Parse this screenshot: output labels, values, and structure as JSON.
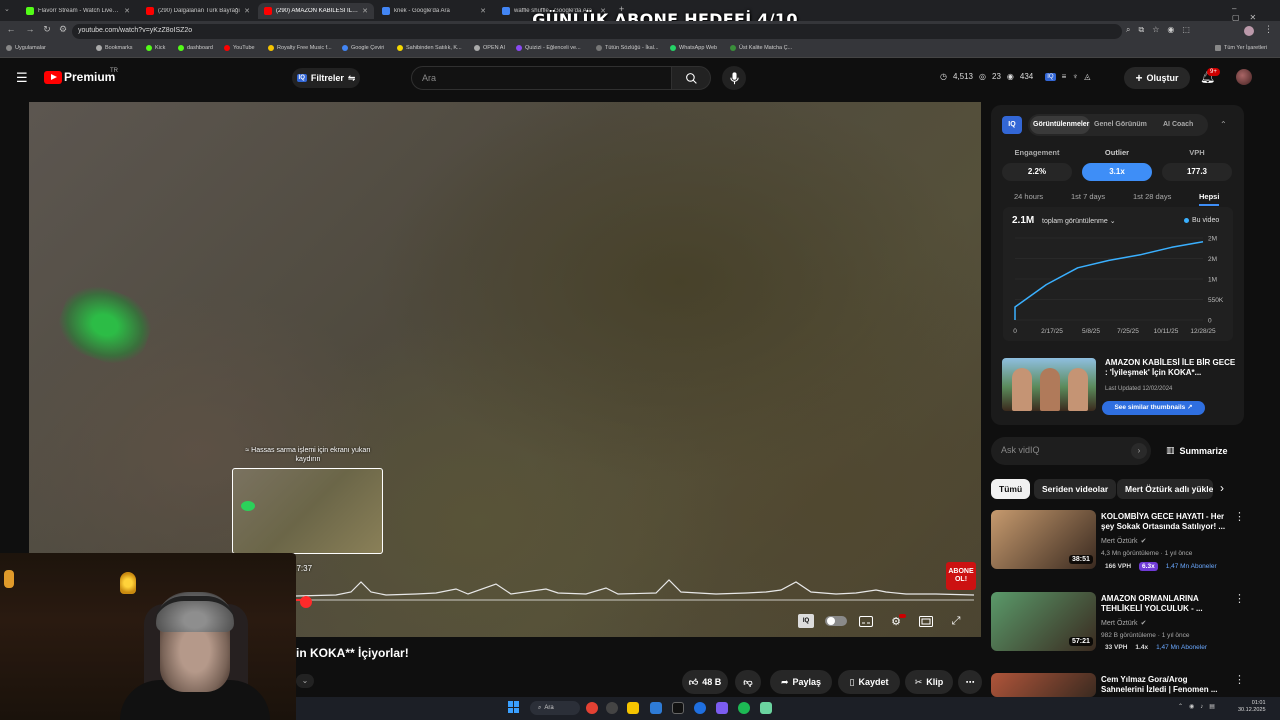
{
  "overlay_title": "GÜNLÜK ABONE HEDEFİ 4/10",
  "browser": {
    "tabs": [
      {
        "title": "Flavorr Stream - Watch Live on",
        "color": "#53fc18"
      },
      {
        "title": "(290) Dalgalanan Türk Bayrağı",
        "color": "#ff0000"
      },
      {
        "title": "(290) AMAZON KABİLESİ İLE BİR",
        "color": "#ff0000"
      },
      {
        "title": "kriek - Google'da Ara",
        "color": "#4285f4"
      },
      {
        "title": "waffle shuffle - Google'da Ara",
        "color": "#4285f4"
      }
    ],
    "url": "youtube.com/watch?v=yKzZ8oISZ2o",
    "bookmarks": [
      {
        "label": "Uygulamalar",
        "color": "#888"
      },
      {
        "label": "Bookmarks",
        "color": "#aaa"
      },
      {
        "label": "Kick",
        "color": "#53fc18"
      },
      {
        "label": "dashboard",
        "color": "#53fc18"
      },
      {
        "label": "YouTube",
        "color": "#ff0000"
      },
      {
        "label": "Royalty Free Music f...",
        "color": "#f5c400"
      },
      {
        "label": "Google Çeviri",
        "color": "#4285f4"
      },
      {
        "label": "Sahibinden Satılık, K...",
        "color": "#f5d800"
      },
      {
        "label": "OPEN AI",
        "color": "#aaa"
      },
      {
        "label": "Quizizi - Eğlenceli ve...",
        "color": "#8a4af3"
      },
      {
        "label": "Tütün Sözlüğü - İkal...",
        "color": "#777"
      },
      {
        "label": "WhatsApp Web",
        "color": "#25d366"
      },
      {
        "label": "Üst Kalite Matcha Ç...",
        "color": "#3a8f3a"
      }
    ],
    "all_bookmarks": "Tüm Yer İşaretleri"
  },
  "header": {
    "logo": "Premium",
    "logo_sup": "TR",
    "filters": "Filtreler",
    "search_placeholder": "Ara",
    "stats": [
      "4,513",
      "23",
      "434"
    ],
    "create": "Oluştur",
    "notif_count": "9+"
  },
  "video": {
    "preview_caption": "Hassas sarma işlemi için ekranı yukarı kaydırın",
    "preview_time": "17:37",
    "abone_badge": "ABONE OL!",
    "iq_badge": "IQ"
  },
  "below_video": {
    "title_fragment": "in KOKA** İçiyorlar!",
    "likes": "48 B",
    "share": "Paylaş",
    "save": "Kaydet",
    "clip": "Klip"
  },
  "iq_panel": {
    "logo": "IQ",
    "tabs": [
      "Görüntülenmeler",
      "Genel Görünüm",
      "AI Coach"
    ],
    "metrics": [
      {
        "label": "Engagement",
        "value": "2.2%"
      },
      {
        "label": "Outlier",
        "value": "3.1x"
      },
      {
        "label": "VPH",
        "value": "177.3"
      }
    ],
    "ranges": [
      "24 hours",
      "1st 7 days",
      "1st 28 days",
      "Hepsi"
    ],
    "total": "2.1M",
    "metric_select": "toplam görüntülenme",
    "legend": "Bu video",
    "related_title": "AMAZON KABİLESİ İLE BİR GECE : 'İyileşmek' İçin KOKA*...",
    "related_updated": "Last Updated 12/02/2024",
    "related_button": "See similar thumbnails",
    "ask_placeholder": "Ask vidIQ",
    "summarize": "Summarize"
  },
  "chart_data": {
    "type": "line",
    "x": [
      "2/17/25",
      "5/8/25",
      "7/25/25",
      "10/11/25",
      "12/28/25"
    ],
    "x_ticks": [
      "0",
      "2/17/25",
      "5/8/25",
      "7/25/25",
      "10/11/25",
      "12/28/25"
    ],
    "y_ticks": [
      "0",
      "550K",
      "1M",
      "2M",
      "2M"
    ],
    "series": [
      {
        "name": "Bu video",
        "values": [
          0.35,
          0.95,
          1.4,
          1.6,
          1.75,
          1.95,
          2.1
        ]
      }
    ],
    "ylim": [
      0,
      2.2
    ],
    "grid": true,
    "color": "#3ab0ff"
  },
  "chips": [
    "Tümü",
    "Seriden videolar",
    "Mert Öztürk adlı yükle"
  ],
  "recommendations": [
    {
      "title": "KOLOMBİYA GECE HAYATI - Her şey Sokak Ortasında Satılıyor! ...",
      "channel": "Mert Öztürk",
      "meta": "4,3 Mn görüntüleme · 1 yıl önce",
      "duration": "38:51",
      "vph": "166 VPH",
      "outlier": "6.3x",
      "subs": "1,47 Mn Aboneler",
      "thumb": "#c69a6e"
    },
    {
      "title": "AMAZON ORMANLARINA TEHLİKELİ YOLCULUK - ...",
      "channel": "Mert Öztürk",
      "meta": "982 B görüntüleme · 1 yıl önce",
      "duration": "57:21",
      "vph": "33 VPH",
      "outlier": "1.4x",
      "subs": "1,47 Mn Aboneler",
      "thumb": "#5a9a6a"
    },
    {
      "title": "Cem Yılmaz Gora/Arog Sahnelerini İzledi | Fenomen ...",
      "channel": "",
      "meta": "",
      "duration": "",
      "vph": "",
      "outlier": "",
      "subs": "",
      "thumb": "#b0553a"
    }
  ],
  "taskbar": {
    "search": "Ara",
    "time": "01:01",
    "date": "30.12.2025"
  }
}
